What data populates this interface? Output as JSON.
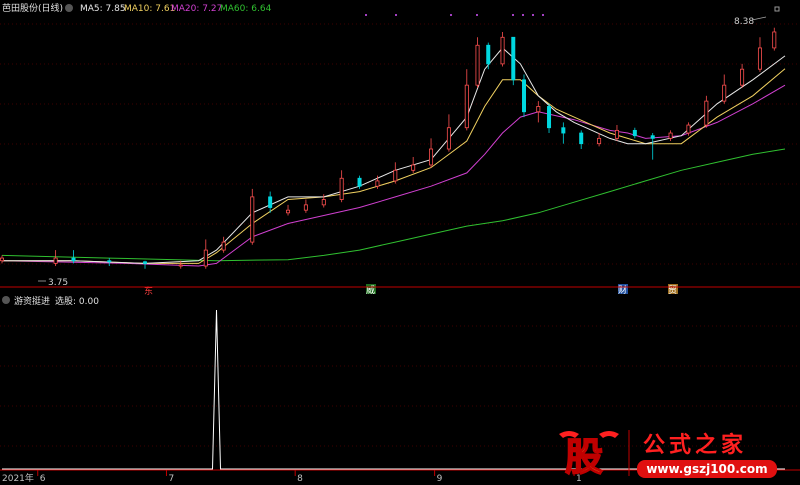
{
  "header": {
    "stock_name": "芭田股份(日线)",
    "ma5": "MA5: 7.85",
    "ma10": "MA10: 7.61",
    "ma20": "MA20: 7.27",
    "ma60": "MA60: 6.64"
  },
  "indicator": {
    "name": "游资挺进",
    "value": "选股: 0.00"
  },
  "annotations": {
    "high_label": "8.38",
    "low_label": "3.75",
    "event_markers": [
      "东",
      "威",
      "财",
      "贸"
    ]
  },
  "xaxis": {
    "year_label": "2021年",
    "months": [
      "6",
      "7",
      "8",
      "9",
      "1"
    ]
  },
  "colors": {
    "background": "#000000",
    "up_candle": "#ff5050",
    "down_candle": "#00d8e0",
    "ma5": "#e8e8e8",
    "ma10": "#f0d060",
    "ma20": "#d040d0",
    "ma60": "#30c030",
    "grid": "#800000",
    "signal": "#ffffff"
  },
  "watermark": {
    "logo_char": "股",
    "brand": "公式之家",
    "url": "www.gszj100.com"
  },
  "chart_data": [
    {
      "type": "candlestick",
      "title": "芭田股份(日线)",
      "series": [
        {
          "name": "MA5",
          "value": 7.85
        },
        {
          "name": "MA10",
          "value": 7.61
        },
        {
          "name": "MA20",
          "value": 7.27
        },
        {
          "name": "MA60",
          "value": 6.64
        }
      ],
      "ylim": [
        3.6,
        8.6
      ],
      "marked_high": 8.38,
      "marked_low": 3.75,
      "x_ticks": [
        "6",
        "7",
        "8",
        "9",
        "1"
      ],
      "ma60_path": [
        [
          0,
          4.1
        ],
        [
          30,
          4.05
        ],
        [
          60,
          4.0
        ],
        [
          80,
          4.02
        ],
        [
          90,
          4.1
        ],
        [
          100,
          4.2
        ],
        [
          110,
          4.35
        ],
        [
          120,
          4.5
        ],
        [
          130,
          4.65
        ],
        [
          140,
          4.75
        ],
        [
          150,
          4.9
        ],
        [
          160,
          5.1
        ],
        [
          170,
          5.3
        ],
        [
          180,
          5.5
        ],
        [
          190,
          5.7
        ],
        [
          200,
          5.85
        ],
        [
          210,
          6.0
        ],
        [
          219,
          6.1
        ]
      ],
      "ma20_path": [
        [
          0,
          4.0
        ],
        [
          35,
          3.95
        ],
        [
          55,
          3.9
        ],
        [
          60,
          3.95
        ],
        [
          65,
          4.2
        ],
        [
          70,
          4.45
        ],
        [
          80,
          4.7
        ],
        [
          90,
          4.85
        ],
        [
          100,
          5.0
        ],
        [
          110,
          5.2
        ],
        [
          120,
          5.4
        ],
        [
          130,
          5.65
        ],
        [
          135,
          6.0
        ],
        [
          140,
          6.4
        ],
        [
          145,
          6.7
        ],
        [
          150,
          6.8
        ],
        [
          160,
          6.65
        ],
        [
          170,
          6.45
        ],
        [
          175,
          6.4
        ],
        [
          180,
          6.3
        ],
        [
          190,
          6.35
        ],
        [
          200,
          6.6
        ],
        [
          210,
          6.95
        ],
        [
          219,
          7.3
        ]
      ],
      "ma10_path": [
        [
          0,
          4.0
        ],
        [
          20,
          4.0
        ],
        [
          40,
          3.95
        ],
        [
          55,
          3.95
        ],
        [
          60,
          4.15
        ],
        [
          70,
          4.7
        ],
        [
          80,
          5.15
        ],
        [
          90,
          5.2
        ],
        [
          100,
          5.3
        ],
        [
          110,
          5.5
        ],
        [
          120,
          5.75
        ],
        [
          130,
          6.25
        ],
        [
          135,
          6.9
        ],
        [
          140,
          7.4
        ],
        [
          145,
          7.4
        ],
        [
          150,
          7.1
        ],
        [
          155,
          6.85
        ],
        [
          160,
          6.7
        ],
        [
          170,
          6.4
        ],
        [
          175,
          6.3
        ],
        [
          180,
          6.2
        ],
        [
          190,
          6.2
        ],
        [
          200,
          6.7
        ],
        [
          210,
          7.1
        ],
        [
          219,
          7.61
        ]
      ],
      "ma5_path": [
        [
          0,
          4.0
        ],
        [
          20,
          4.0
        ],
        [
          40,
          3.95
        ],
        [
          55,
          4.0
        ],
        [
          60,
          4.2
        ],
        [
          70,
          4.9
        ],
        [
          80,
          5.2
        ],
        [
          90,
          5.2
        ],
        [
          100,
          5.4
        ],
        [
          110,
          5.7
        ],
        [
          120,
          5.9
        ],
        [
          130,
          6.7
        ],
        [
          135,
          7.6
        ],
        [
          140,
          8.0
        ],
        [
          145,
          7.7
        ],
        [
          150,
          7.1
        ],
        [
          155,
          6.8
        ],
        [
          160,
          6.6
        ],
        [
          170,
          6.3
        ],
        [
          175,
          6.2
        ],
        [
          180,
          6.2
        ],
        [
          190,
          6.35
        ],
        [
          200,
          6.95
        ],
        [
          210,
          7.4
        ],
        [
          219,
          7.85
        ]
      ],
      "candles": [
        [
          0,
          4.0,
          4.05,
          4.1,
          3.95
        ],
        [
          15,
          3.95,
          4.05,
          4.2,
          3.9
        ],
        [
          20,
          4.05,
          4.0,
          4.2,
          3.95
        ],
        [
          30,
          4.0,
          3.98,
          4.05,
          3.9
        ],
        [
          40,
          3.98,
          3.95,
          4.0,
          3.85
        ],
        [
          50,
          3.9,
          3.92,
          4.0,
          3.85
        ],
        [
          57,
          3.9,
          4.2,
          4.4,
          3.85
        ],
        [
          62,
          4.2,
          4.35,
          4.45,
          4.15
        ],
        [
          70,
          4.35,
          5.2,
          5.35,
          4.3
        ],
        [
          75,
          5.2,
          5.0,
          5.3,
          4.9
        ],
        [
          80,
          4.9,
          4.95,
          5.05,
          4.85
        ],
        [
          85,
          4.95,
          5.05,
          5.15,
          4.9
        ],
        [
          90,
          5.05,
          5.15,
          5.25,
          5.0
        ],
        [
          95,
          5.15,
          5.55,
          5.7,
          5.1
        ],
        [
          100,
          5.55,
          5.4,
          5.6,
          5.35
        ],
        [
          105,
          5.4,
          5.5,
          5.6,
          5.35
        ],
        [
          110,
          5.5,
          5.7,
          5.85,
          5.45
        ],
        [
          115,
          5.7,
          5.8,
          5.95,
          5.65
        ],
        [
          120,
          5.8,
          6.1,
          6.3,
          5.75
        ],
        [
          125,
          6.1,
          6.5,
          6.75,
          6.05
        ],
        [
          130,
          6.5,
          7.3,
          7.6,
          6.45
        ],
        [
          133,
          7.3,
          8.05,
          8.2,
          7.25
        ],
        [
          136,
          8.05,
          7.7,
          8.1,
          7.6
        ],
        [
          140,
          7.7,
          8.2,
          8.3,
          7.65
        ],
        [
          143,
          8.2,
          7.4,
          8.2,
          7.3
        ],
        [
          146,
          7.4,
          6.8,
          7.5,
          6.7
        ],
        [
          150,
          6.8,
          6.9,
          7.0,
          6.6
        ],
        [
          153,
          6.9,
          6.5,
          6.95,
          6.4
        ],
        [
          157,
          6.5,
          6.4,
          6.6,
          6.2
        ],
        [
          162,
          6.4,
          6.2,
          6.45,
          6.1
        ],
        [
          167,
          6.2,
          6.3,
          6.4,
          6.15
        ],
        [
          172,
          6.3,
          6.45,
          6.55,
          6.25
        ],
        [
          177,
          6.45,
          6.35,
          6.5,
          6.3
        ],
        [
          182,
          6.35,
          6.3,
          6.4,
          5.9
        ],
        [
          187,
          6.3,
          6.4,
          6.45,
          6.25
        ],
        [
          192,
          6.4,
          6.55,
          6.6,
          6.35
        ],
        [
          197,
          6.55,
          7.0,
          7.1,
          6.5
        ],
        [
          202,
          7.0,
          7.3,
          7.5,
          6.95
        ],
        [
          207,
          7.3,
          7.6,
          7.7,
          7.25
        ],
        [
          212,
          7.6,
          8.0,
          8.2,
          7.55
        ],
        [
          216,
          8.0,
          8.3,
          8.38,
          7.95
        ]
      ]
    },
    {
      "type": "line",
      "title": "游资挺进",
      "series": [
        {
          "name": "选股",
          "value": 0.0
        }
      ],
      "ylim": [
        0,
        1
      ],
      "signal_x": 60,
      "signal_y": 1
    }
  ]
}
